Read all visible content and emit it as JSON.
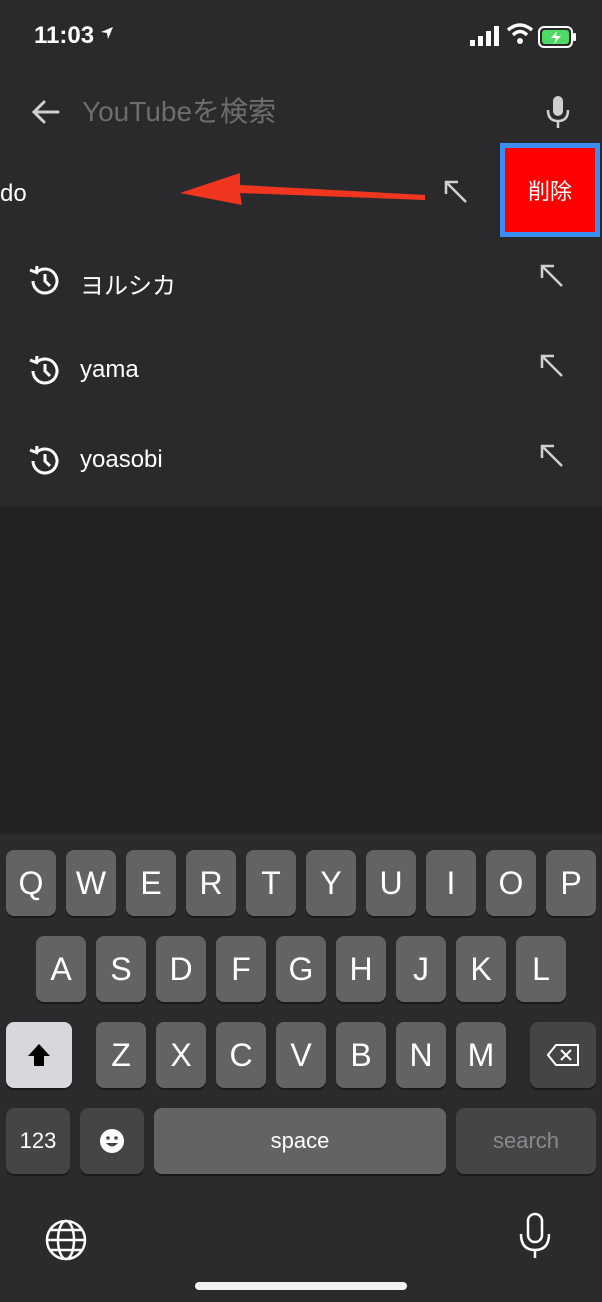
{
  "status_bar": {
    "time": "11:03"
  },
  "search": {
    "placeholder": "YouTubeを検索",
    "value": ""
  },
  "swiped_item": {
    "label": "do",
    "delete_label": "削除"
  },
  "history": [
    {
      "label": "ヨルシカ"
    },
    {
      "label": "yama"
    },
    {
      "label": "yoasobi"
    }
  ],
  "keyboard": {
    "row1": [
      "Q",
      "W",
      "E",
      "R",
      "T",
      "Y",
      "U",
      "I",
      "O",
      "P"
    ],
    "row2": [
      "A",
      "S",
      "D",
      "F",
      "G",
      "H",
      "J",
      "K",
      "L"
    ],
    "row3": [
      "Z",
      "X",
      "C",
      "V",
      "B",
      "N",
      "M"
    ],
    "numbers_label": "123",
    "space_label": "space",
    "search_label": "search"
  },
  "colors": {
    "background": "#232325",
    "header": "#2a2a2c",
    "delete_bg": "#ff0000",
    "highlight_border": "#3a8ef0",
    "arrow": "#f0361e"
  }
}
